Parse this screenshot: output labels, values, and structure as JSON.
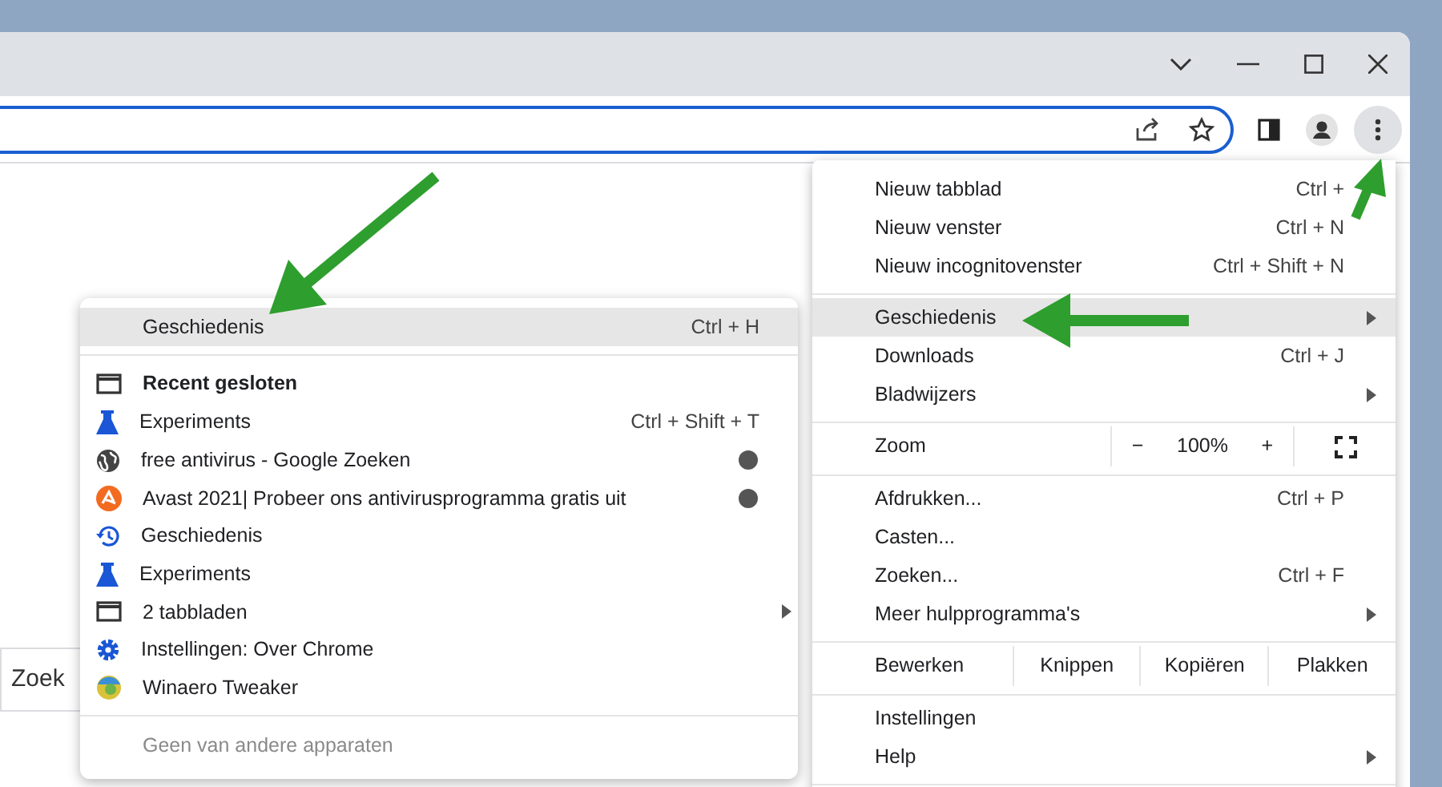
{
  "page": {
    "search_text": "Zoek"
  },
  "menu": {
    "items": [
      {
        "kind": "item",
        "label": "Nieuw tabblad",
        "shortcut": "Ctrl +",
        "selected": false,
        "submenu": false
      },
      {
        "kind": "item",
        "label": "Nieuw venster",
        "shortcut": "Ctrl + N",
        "selected": false,
        "submenu": false
      },
      {
        "kind": "item",
        "label": "Nieuw incognitovenster",
        "shortcut": "Ctrl + Shift + N",
        "selected": false,
        "submenu": false
      },
      {
        "kind": "separator"
      },
      {
        "kind": "item",
        "label": "Geschiedenis",
        "selected": true,
        "submenu": true
      },
      {
        "kind": "item",
        "label": "Downloads",
        "shortcut": "Ctrl + J",
        "selected": false,
        "submenu": false
      },
      {
        "kind": "item",
        "label": "Bladwijzers",
        "selected": false,
        "submenu": true
      },
      {
        "kind": "separator"
      },
      {
        "kind": "zoom",
        "label": "Zoom",
        "minus": "−",
        "value": "100%",
        "plus": "+"
      },
      {
        "kind": "separator"
      },
      {
        "kind": "item",
        "label": "Afdrukken...",
        "shortcut": "Ctrl + P",
        "selected": false,
        "submenu": false
      },
      {
        "kind": "item",
        "label": "Casten...",
        "selected": false,
        "submenu": false
      },
      {
        "kind": "item",
        "label": "Zoeken...",
        "shortcut": "Ctrl + F",
        "selected": false,
        "submenu": false
      },
      {
        "kind": "item",
        "label": "Meer hulpprogramma's",
        "selected": false,
        "submenu": true
      },
      {
        "kind": "separator"
      },
      {
        "kind": "edit",
        "label": "Bewerken",
        "buttons": [
          "Knippen",
          "Kopiëren",
          "Plakken"
        ]
      },
      {
        "kind": "separator"
      },
      {
        "kind": "item",
        "label": "Instellingen",
        "selected": false,
        "submenu": false
      },
      {
        "kind": "item",
        "label": "Help",
        "selected": false,
        "submenu": true
      },
      {
        "kind": "separator"
      }
    ]
  },
  "history_menu": {
    "items": [
      {
        "kind": "header",
        "label": "Geschiedenis",
        "shortcut": "Ctrl + H",
        "selected": true
      },
      {
        "kind": "separator"
      },
      {
        "kind": "window",
        "label": "Recent gesloten",
        "bold": true
      },
      {
        "kind": "flask",
        "label": "Experiments",
        "shortcut": "Ctrl + Shift + T"
      },
      {
        "kind": "globe",
        "label": "free antivirus - Google Zoeken",
        "dot": true
      },
      {
        "kind": "avast",
        "label": "Avast 2021| Probeer ons antivirusprogramma gratis uit",
        "dot": true
      },
      {
        "kind": "history",
        "label": "Geschiedenis"
      },
      {
        "kind": "flask",
        "label": "Experiments"
      },
      {
        "kind": "window",
        "label": "2 tabbladen",
        "submenu": true
      },
      {
        "kind": "gear",
        "label": "Instellingen: Over Chrome"
      },
      {
        "kind": "winaero",
        "label": "Winaero Tweaker"
      },
      {
        "kind": "separator"
      },
      {
        "kind": "note",
        "label": "Geen van andere apparaten",
        "disabled": true
      }
    ]
  }
}
